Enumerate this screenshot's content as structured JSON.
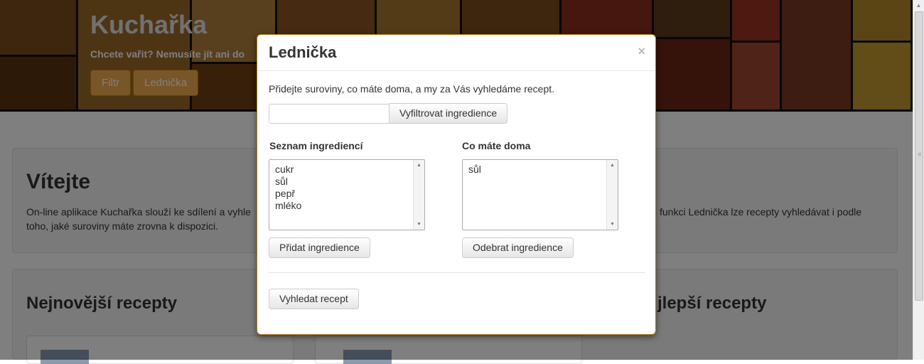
{
  "page": {
    "site_title": "Kuchařka",
    "tagline": "Chcete vařit? Nemusíte jít ani do",
    "nav_buttons": [
      "Filtr",
      "Lednička"
    ],
    "welcome": {
      "heading": "Vítejte",
      "line1_left": "On-line aplikace Kuchařka slouží ke sdílení a vyhle",
      "line1_right": "funkci Lednička lze recepty vyhledávat i podle",
      "line2": "toho, jaké suroviny máte zrovna k dispozici."
    },
    "sections": {
      "newest": "Nejnovější recepty",
      "best_fragment": "jlepší recepty"
    }
  },
  "modal": {
    "title": "Lednička",
    "close": "×",
    "intro": "Přidejte suroviny, co máte doma, a my za Vás vyhledáme recept.",
    "filter_input": {
      "value": "",
      "placeholder": ""
    },
    "filter_button": "Vyfiltrovat ingredience",
    "left": {
      "label": "Seznam ingrediencí",
      "items": [
        "cukr",
        "sůl",
        "pepř",
        "mléko"
      ],
      "button": "Přidat ingredience"
    },
    "right": {
      "label": "Co máte doma",
      "items": [
        "sůl"
      ],
      "button": "Odebrat ingredience"
    },
    "search_button": "Vyhledat recept"
  },
  "colors": {
    "hero_button": "#f0ad4e",
    "modal_border": "#b07a1a",
    "backdrop": "rgba(0,0,0,0.5)"
  }
}
